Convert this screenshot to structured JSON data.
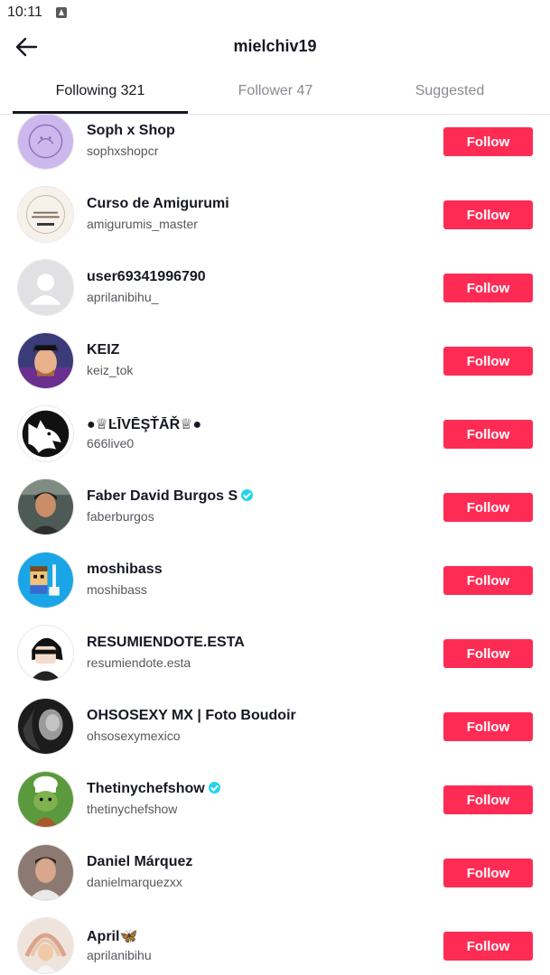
{
  "status_bar": {
    "time": "10:11"
  },
  "header": {
    "title": "mielchiv19"
  },
  "tabs": [
    {
      "label": "Following 321",
      "active": true
    },
    {
      "label": "Follower 47",
      "active": false
    },
    {
      "label": "Suggested",
      "active": false
    }
  ],
  "colors": {
    "accent": "#fe2c55",
    "text": "#161823",
    "muted": "#8a8b91",
    "verified": "#20d5ec"
  },
  "follow_label": "Follow",
  "users": [
    {
      "name": "Soph x Shop",
      "handle": "sophxshopcr",
      "verified": false,
      "avatar": "lavender-logo"
    },
    {
      "name": "Curso de Amigurumi",
      "handle": "amigurumis_master",
      "verified": false,
      "avatar": "crochet-logo"
    },
    {
      "name": "user69341996790",
      "handle": "aprilanibihu_",
      "verified": false,
      "avatar": "default-avatar"
    },
    {
      "name": "KEIZ",
      "handle": "keiz_tok",
      "verified": false,
      "avatar": "cartoon-portrait"
    },
    {
      "name": "●♕ĿĪVĒŞŤĀŘ♕●",
      "handle": "666live0",
      "verified": false,
      "avatar": "wolf-silhouette"
    },
    {
      "name": "Faber David Burgos S",
      "handle": "faberburgos",
      "verified": true,
      "avatar": "photo-portrait"
    },
    {
      "name": "moshibass",
      "handle": "moshibass",
      "verified": false,
      "avatar": "pixel-art"
    },
    {
      "name": "RESUMIENDOTE.ESTA",
      "handle": "resumiendote.esta",
      "verified": false,
      "avatar": "cartoon-character"
    },
    {
      "name": "OHSOSEXY MX | Foto Boudoir",
      "handle": "ohsosexymexico",
      "verified": false,
      "avatar": "bw-photo"
    },
    {
      "name": "Thetinychefshow",
      "handle": "thetinychefshow",
      "verified": true,
      "avatar": "tiny-chef"
    },
    {
      "name": "Daniel Márquez",
      "handle": "danielmarquezxx",
      "verified": false,
      "avatar": "photo-portrait"
    },
    {
      "name": "April🦋",
      "handle": "aprilanibihu",
      "verified": false,
      "avatar": "baby-photo"
    }
  ]
}
